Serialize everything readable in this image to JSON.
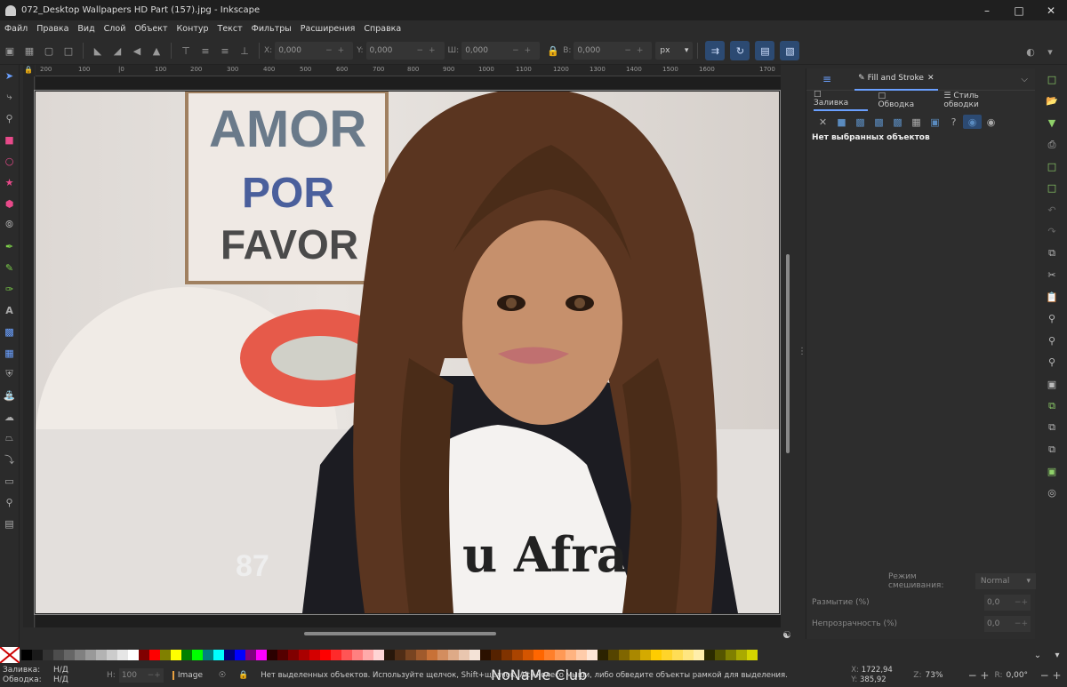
{
  "window": {
    "title": "072_Desktop Wallpapers  HD Part (157).jpg - Inkscape"
  },
  "menu": [
    "Файл",
    "Правка",
    "Вид",
    "Слой",
    "Объект",
    "Контур",
    "Текст",
    "Фильтры",
    "Расширения",
    "Справка"
  ],
  "toolbar": {
    "x_label": "X:",
    "x_value": "0,000",
    "y_label": "Y:",
    "y_value": "0,000",
    "w_label": "Ш:",
    "w_value": "0,000",
    "h_label": "В:",
    "h_value": "0,000",
    "unit": "px"
  },
  "ruler_top": [
    "200",
    "100",
    "|0",
    "100",
    "200",
    "300",
    "400",
    "500",
    "600",
    "700",
    "800",
    "900",
    "1000",
    "1100",
    "1200",
    "1300",
    "1400",
    "1500",
    "1600",
    "1700"
  ],
  "photo": {
    "sign_lines": [
      "AMOR",
      "POR",
      "FAVOR"
    ],
    "shirt_text": "u Afra",
    "sleeve_number": "87"
  },
  "panel": {
    "tab_title": "Fill and Stroke",
    "tabs": [
      "Заливка",
      "Обводка",
      "Стиль обводки"
    ],
    "no_selection": "Нет выбранных объектов",
    "blend_label": "Режим смешивания:",
    "blend_value": "Normal",
    "blur_label": "Размытие (%)",
    "blur_value": "0,0",
    "opacity_label": "Непрозрачность (%)",
    "opacity_value": "0,0"
  },
  "status": {
    "fill_label": "Заливка:",
    "fill_value": "Н/Д",
    "stroke_label": "Обводка:",
    "stroke_value": "Н/Д",
    "h_label": "Н:",
    "h_value": "100",
    "layer": "Image",
    "message": "Нет выделенных объектов. Используйте щелчок, Shift+щелчок, Alt+колесо мыши, либо обведите объекты рамкой для выделения.",
    "watermark": "NoNaMe Club",
    "x_label": "X:",
    "x_value": "1722,94",
    "y_label": "Y:",
    "y_value": "385,92",
    "z_label": "Z:",
    "zoom": "73%",
    "r_label": "R:",
    "rotation": "0,00°"
  },
  "palette_colors": [
    "#000000",
    "#1a1a1a",
    "#333333",
    "#4d4d4d",
    "#666666",
    "#808080",
    "#999999",
    "#b3b3b3",
    "#cccccc",
    "#e6e6e6",
    "#ffffff",
    "#800000",
    "#ff0000",
    "#808000",
    "#ffff00",
    "#008000",
    "#00ff00",
    "#008080",
    "#00ffff",
    "#000080",
    "#0000ff",
    "#800080",
    "#ff00ff",
    "#2b0000",
    "#550000",
    "#800000",
    "#aa0000",
    "#d40000",
    "#ff0000",
    "#ff2a2a",
    "#ff5555",
    "#ff8080",
    "#ffaaaa",
    "#ffd5d5",
    "#28170b",
    "#502d16",
    "#784421",
    "#a05a2c",
    "#c87137",
    "#d38d5f",
    "#deaa87",
    "#e9c6af",
    "#f4e3d7",
    "#2b1100",
    "#552200",
    "#803300",
    "#aa4400",
    "#d45500",
    "#ff6600",
    "#ff7f2a",
    "#ff9955",
    "#ffb380",
    "#ffccaa",
    "#ffe6d5",
    "#2b2200",
    "#554400",
    "#806600",
    "#aa8800",
    "#d4aa00",
    "#ffcc00",
    "#ffd42a",
    "#ffdd55",
    "#ffe680",
    "#ffeeaa",
    "#2b2b00",
    "#555500",
    "#808000",
    "#aaaa00",
    "#d4d400"
  ]
}
